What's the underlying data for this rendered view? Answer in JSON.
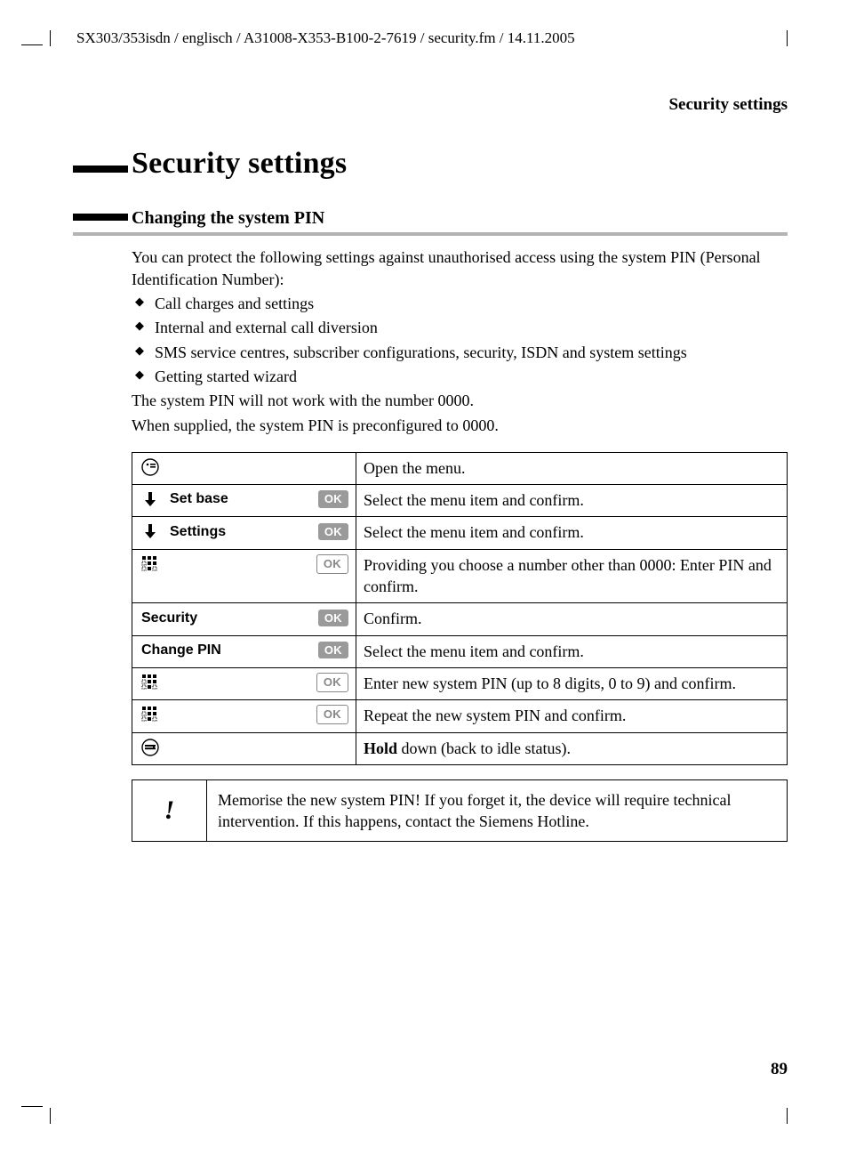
{
  "doc_path": "SX303/353isdn / englisch / A31008-X353-B100-2-7619 / security.fm / 14.11.2005",
  "running_head": "Security settings",
  "page_title": "Security settings",
  "section_title": "Changing the system PIN",
  "intro": "You can protect the following settings against unauthorised access using the system PIN (Personal Identification Number):",
  "bullets": [
    "Call charges and settings",
    "Internal and external call diversion",
    "SMS service centres, subscriber configurations, security, ISDN and system settings",
    "Getting started wizard"
  ],
  "after_list_1": "The system PIN will not work with the number 0000.",
  "after_list_2": "When supplied, the system PIN is preconfigured to 0000.",
  "steps": [
    {
      "icon": "menu-open",
      "label": "",
      "ok": false,
      "desc": "Open the menu."
    },
    {
      "icon": "down-arrow",
      "label": "Set base",
      "ok": true,
      "desc": "Select the menu item and confirm."
    },
    {
      "icon": "down-arrow",
      "label": "Settings",
      "ok": true,
      "desc": "Select the menu item and confirm."
    },
    {
      "icon": "keypad",
      "label": "",
      "ok": true,
      "desc": "Providing you choose a number other than 0000: Enter PIN and confirm."
    },
    {
      "icon": "",
      "label": "Security",
      "ok": true,
      "desc": "Confirm."
    },
    {
      "icon": "",
      "label": "Change PIN",
      "ok": true,
      "desc": "Select the menu item and confirm."
    },
    {
      "icon": "keypad",
      "label": "",
      "ok": true,
      "desc": "Enter new system PIN (up to 8 digits, 0 to 9) and confirm."
    },
    {
      "icon": "keypad",
      "label": "",
      "ok": true,
      "desc": "Repeat the new system PIN and confirm."
    },
    {
      "icon": "hangup",
      "label": "",
      "ok": false,
      "desc_pre_bold": "Hold",
      "desc_post": " down (back to idle status)."
    }
  ],
  "ok_label": "OK",
  "note_icon": "!",
  "note_text": "Memorise the new system PIN! If you forget it, the device will require technical intervention. If this happens, contact the Siemens Hotline.",
  "page_number": "89"
}
